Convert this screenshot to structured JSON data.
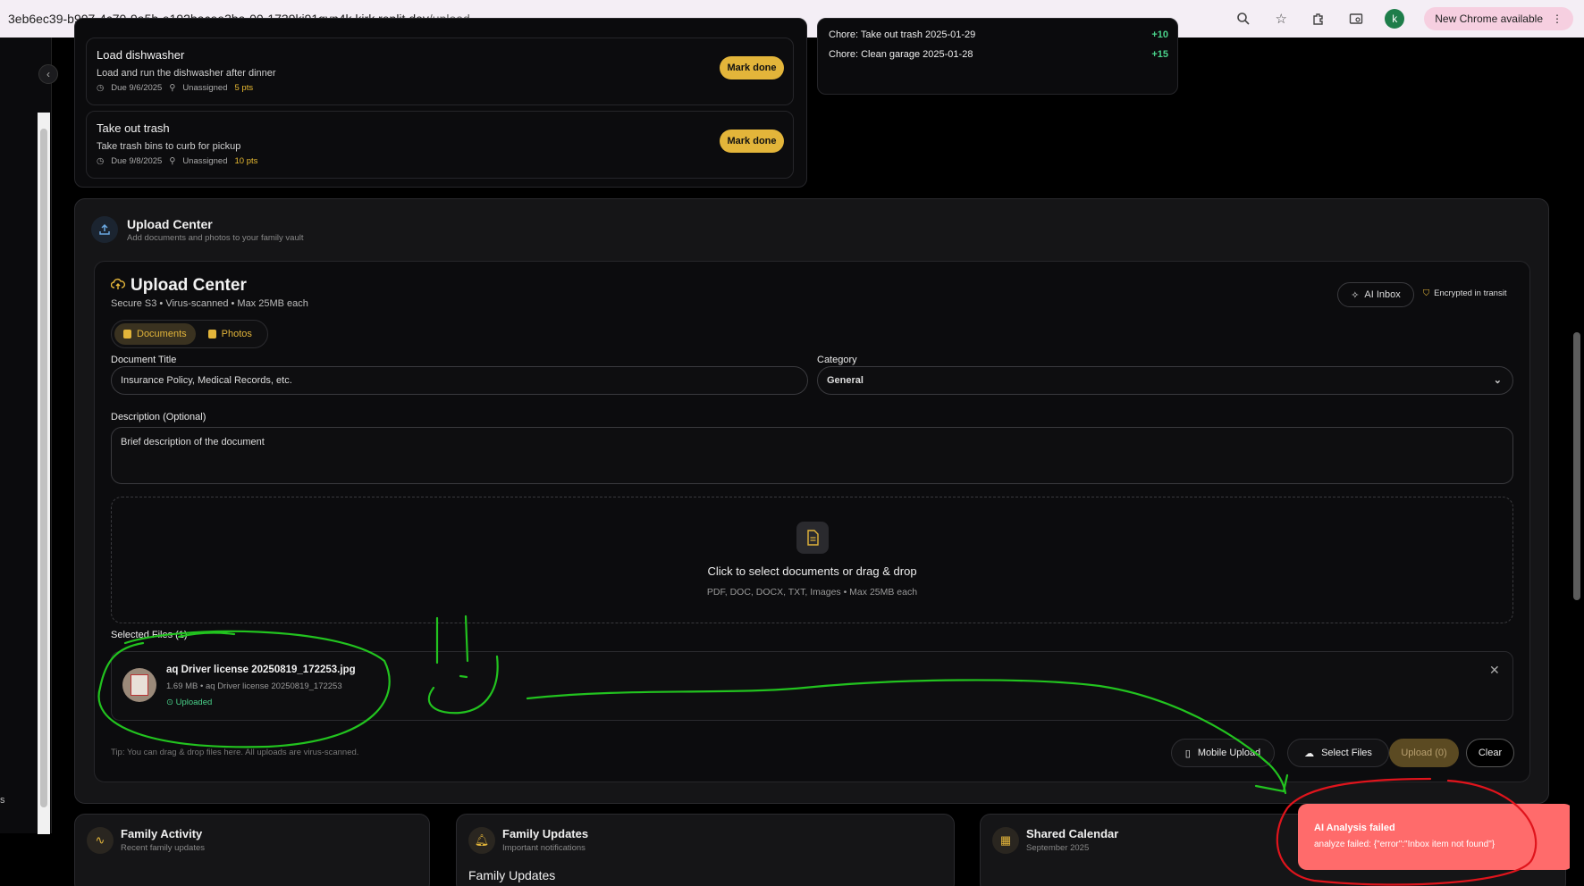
{
  "browser": {
    "url_host": "3eb6ec39-b907-4c70-9a5b-e192bacee3ba-00-1739ki91gyn4k.kirk.replit.dev",
    "url_path": "/upload",
    "avatar_letter": "k",
    "new_chrome_label": "New Chrome available"
  },
  "chores": [
    {
      "title": "Load dishwasher",
      "desc": "Load and run the dishwasher after dinner",
      "due": "Due 9/6/2025",
      "assignee": "Unassigned",
      "points": "5 pts",
      "action": "Mark done"
    },
    {
      "title": "Take out trash",
      "desc": "Take trash bins to curb for pickup",
      "due": "Due 9/8/2025",
      "assignee": "Unassigned",
      "points": "10 pts",
      "action": "Mark done"
    }
  ],
  "recent": {
    "items": [
      {
        "text": "Chore: Take out trash 2025-01-29",
        "points": "+10"
      },
      {
        "text": "Chore: Clean garage 2025-01-28",
        "points": "+15"
      }
    ]
  },
  "upload_section": {
    "title": "Upload Center",
    "subtitle": "Add documents and photos to your family vault"
  },
  "upload_center": {
    "title": "Upload Center",
    "subtitle": "Secure S3  •  Virus-scanned  •  Max 25MB each",
    "ai_inbox": "AI Inbox",
    "encrypted": "Encrypted in transit",
    "tabs": [
      "Documents",
      "Photos"
    ],
    "doc_title_label": "Document Title",
    "doc_title_placeholder": "Insurance Policy, Medical Records, etc.",
    "category_label": "Category",
    "category_value": "General",
    "description_label": "Description (Optional)",
    "description_placeholder": "Brief description of the document",
    "dropzone_main": "Click to select documents or drag & drop",
    "dropzone_sub": "PDF, DOC, DOCX, TXT, Images  •  Max 25MB each",
    "selected_label": "Selected Files (1)",
    "file": {
      "name": "aq Driver license 20250819_172253.jpg",
      "meta": "1.69 MB  • aq Driver license 20250819_172253",
      "status": "Uploaded"
    },
    "tip": "Tip: You can drag & drop files here. All uploads are virus-scanned.",
    "buttons": {
      "mobile": "Mobile Upload",
      "select": "Select Files",
      "upload": "Upload (0)",
      "clear": "Clear"
    }
  },
  "bottom_cards": [
    {
      "title": "Family Activity",
      "sub": "Recent family updates"
    },
    {
      "title": "Family Updates",
      "sub": "Important notifications",
      "extra": "Family Updates"
    },
    {
      "title": "Shared Calendar",
      "sub": "September 2025"
    }
  ],
  "toast": {
    "title": "AI Analysis failed",
    "message": "analyze failed: {\"error\":\"Inbox item not found\"}"
  },
  "sidebar": {
    "stray_char": "s"
  }
}
